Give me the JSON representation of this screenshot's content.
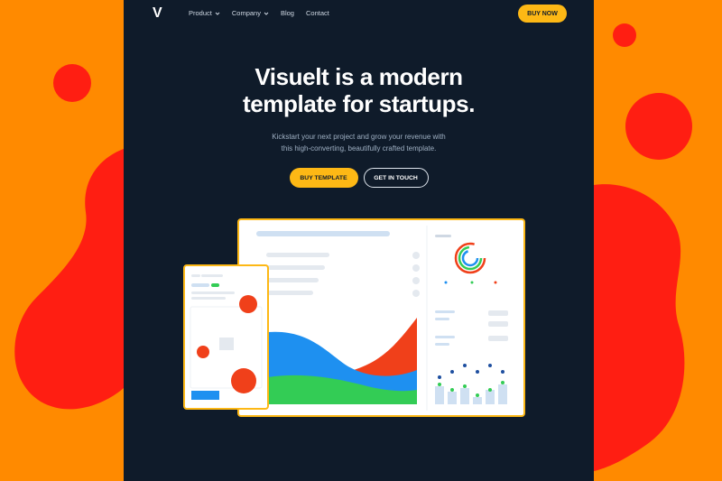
{
  "colors": {
    "background": "#ff8a00",
    "blob": "#ff1e12",
    "page": "#0f1b2a",
    "accent": "#fdb815",
    "chart_blue": "#1e90f0",
    "chart_green": "#33cc55",
    "chart_red": "#f0401a"
  },
  "nav": {
    "logo": "V",
    "links": [
      {
        "label": "Product",
        "icon": "chevron-down-icon"
      },
      {
        "label": "Company",
        "icon": "chevron-down-icon"
      },
      {
        "label": "Blog"
      },
      {
        "label": "Contact"
      }
    ],
    "cta": "BUY NOW"
  },
  "hero": {
    "title_line1": "Visuelt is a modern",
    "title_line2": "template for startups.",
    "subtitle_line1": "Kickstart your next project and grow your revenue with",
    "subtitle_line2": "this high-converting, beautifully crafted template.",
    "primary_button": "BUY TEMPLATE",
    "secondary_button": "GET IN TOUCH"
  }
}
